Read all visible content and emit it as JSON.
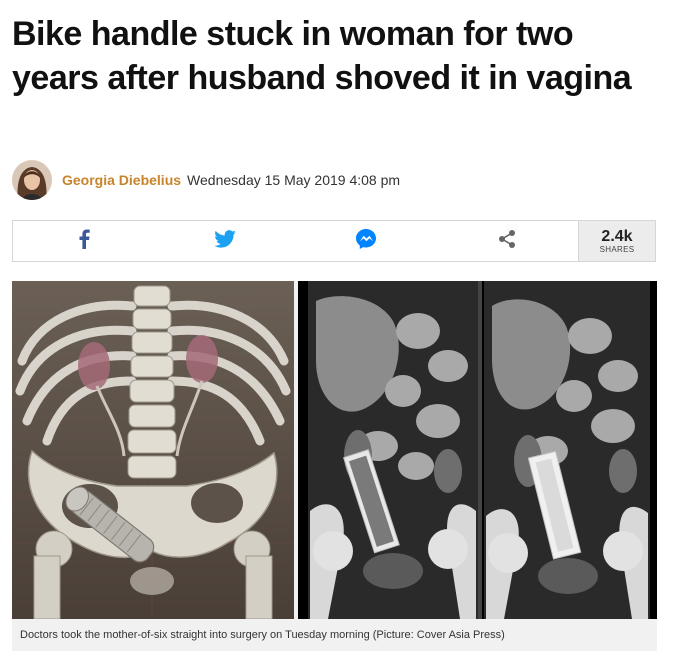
{
  "article": {
    "headline": "Bike handle stuck in woman for two years after husband shoved it in vagina",
    "author": "Georgia Diebelius",
    "date": "Wednesday 15 May 2019 4:08 pm"
  },
  "share": {
    "buttons": [
      {
        "name": "facebook",
        "icon": "facebook-icon",
        "color": "#3b5998"
      },
      {
        "name": "twitter",
        "icon": "twitter-icon",
        "color": "#1da1f2"
      },
      {
        "name": "messenger",
        "icon": "messenger-icon",
        "color": "#0084ff"
      },
      {
        "name": "share",
        "icon": "share-icon",
        "color": "#666666"
      }
    ],
    "count": "2.4k",
    "count_label": "SHARES"
  },
  "figure": {
    "caption": "Doctors took the mother-of-six straight into surgery on Tuesday morning (Picture: Cover Asia Press)"
  },
  "colors": {
    "author": "#c8842a",
    "share_count_bg": "#ececec",
    "caption_bg": "#f1f1f1"
  }
}
